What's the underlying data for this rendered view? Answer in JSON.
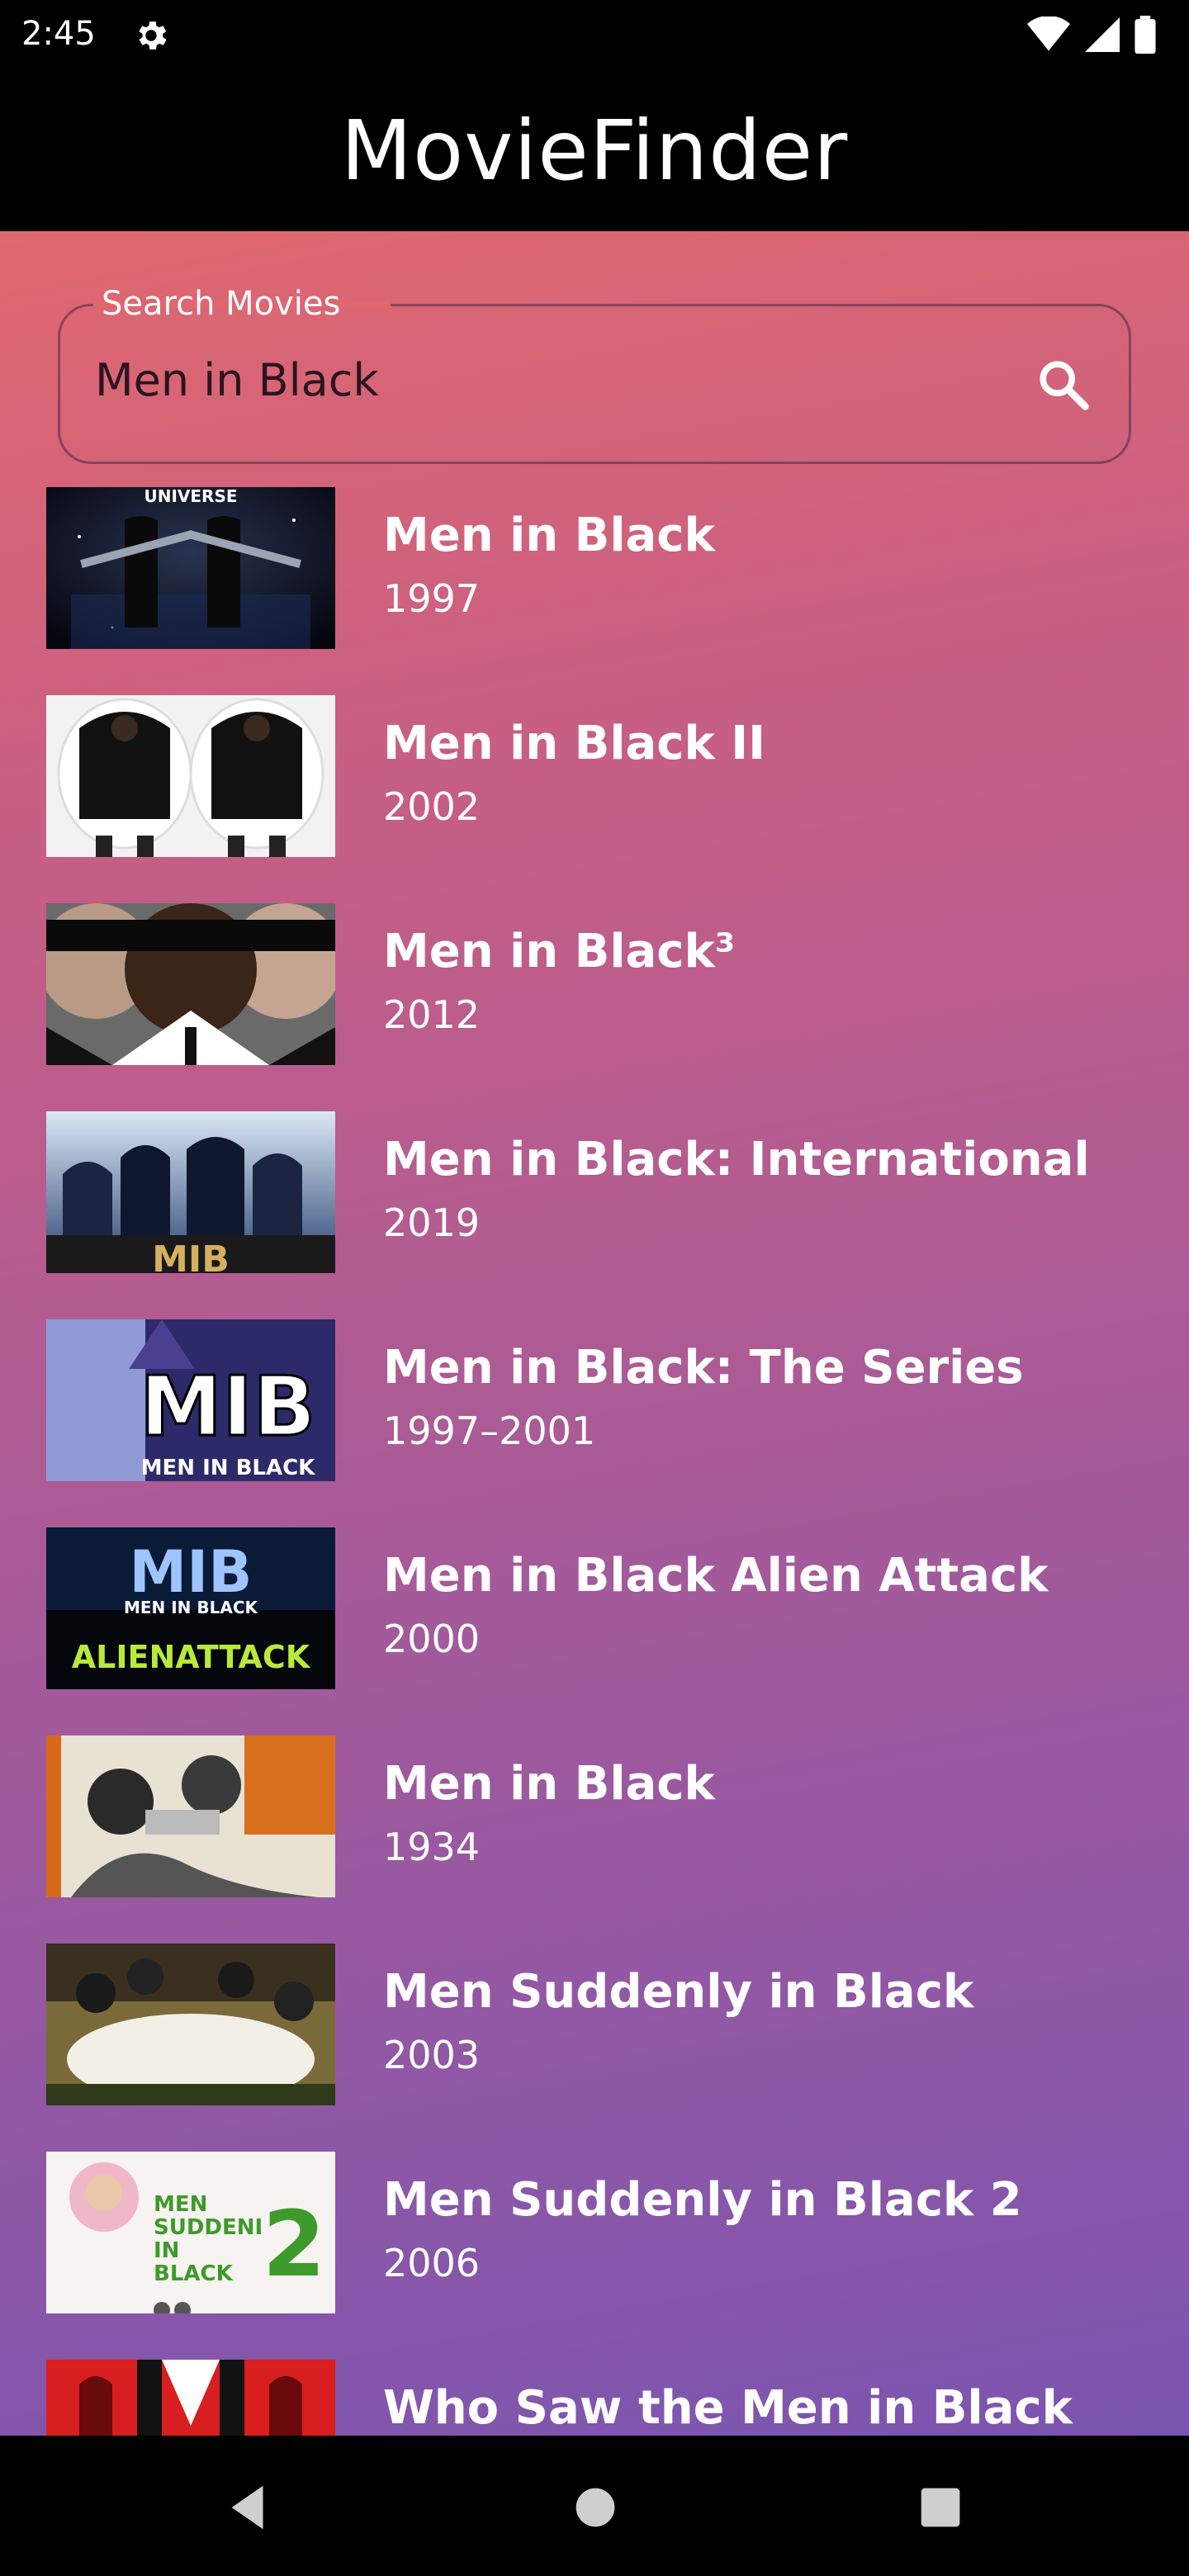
{
  "status": {
    "time": "2:45"
  },
  "app": {
    "title": "MovieFinder"
  },
  "search": {
    "label": "Search Movies",
    "value": "Men in Black"
  },
  "results": [
    {
      "title": "Men in Black",
      "year": "1997"
    },
    {
      "title": "Men in Black II",
      "year": "2002"
    },
    {
      "title": "Men in Black³",
      "year": "2012"
    },
    {
      "title": "Men in Black: International",
      "year": "2019"
    },
    {
      "title": "Men in Black: The Series",
      "year": "1997–2001"
    },
    {
      "title": "Men in Black Alien Attack",
      "year": "2000"
    },
    {
      "title": "Men in Black",
      "year": "1934"
    },
    {
      "title": "Men Suddenly in Black",
      "year": "2003"
    },
    {
      "title": "Men Suddenly in Black 2",
      "year": "2006"
    },
    {
      "title": "Who Saw the Men in Black",
      "year": ""
    }
  ],
  "posters": [
    {
      "text": "UNIVERSE"
    },
    {
      "text": ""
    },
    {
      "text": ""
    },
    {
      "text": "MIB"
    },
    {
      "text": "MIB",
      "sub": "MEN IN BLACK"
    },
    {
      "text": "MIB",
      "sub": "MEN IN BLACK",
      "sub2": "ALIENATTACK"
    },
    {
      "text": ""
    },
    {
      "text": ""
    },
    {
      "text": "MEN SUDDENLY IN BLACK",
      "sub": "2"
    },
    {
      "text": ""
    }
  ],
  "colors": {
    "gradient_start": "#e0686f",
    "gradient_end": "#7b55b0",
    "bar": "#000000",
    "text": "#ffffff"
  }
}
